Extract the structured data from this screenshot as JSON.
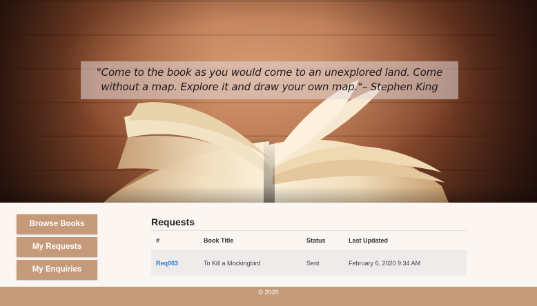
{
  "hero": {
    "quote": "\"Come to the book as you would come to an unexplored land. Come without a map. Explore it and draw your own map.\"– Stephen King"
  },
  "sidebar": {
    "items": [
      {
        "label": "Browse Books"
      },
      {
        "label": "My Requests"
      },
      {
        "label": "My Enquiries"
      }
    ]
  },
  "main": {
    "title": "Requests",
    "table": {
      "headers": [
        "#",
        "Book Title",
        "Status",
        "Last Updated"
      ],
      "rows": [
        {
          "id": "Req003",
          "title": "To Kill a Mockingbird",
          "status": "Sent",
          "updated": "February 6, 2020 9:34 AM"
        }
      ]
    }
  },
  "footer": {
    "text": "© 2020"
  },
  "colors": {
    "accent": "#c59a7a",
    "link": "#2a7ad0",
    "page_bg": "#fbf6f2"
  }
}
